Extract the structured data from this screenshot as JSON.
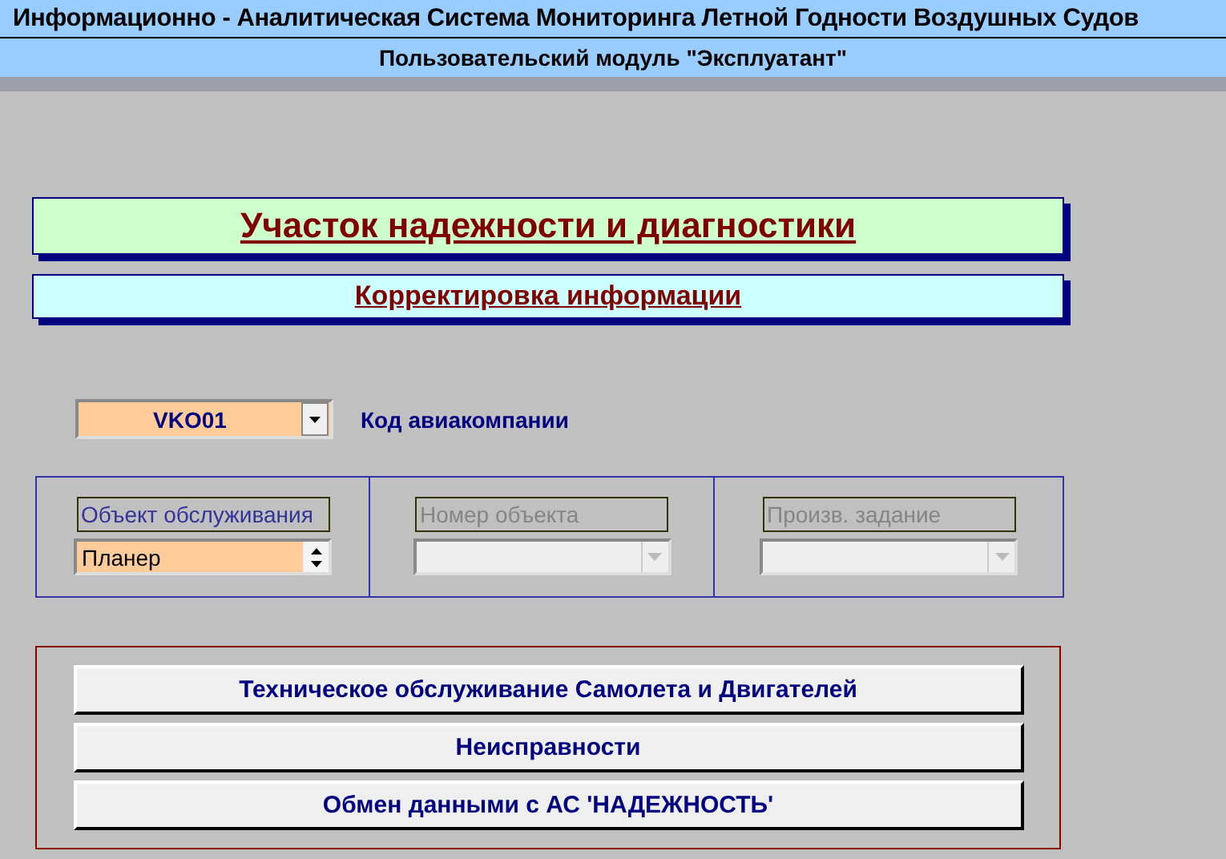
{
  "header": {
    "title": "Информационно - Аналитическая Система Мониторинга Летной Годности Воздушных Судов",
    "subtitle": "Пользовательский модуль \"Эксплуатант\""
  },
  "section_title": "Участок надежности и диагностики",
  "subsection_title": "Корректировка  информации",
  "airline": {
    "value": "VKO01",
    "label": "Код авиакомпании"
  },
  "fields": [
    {
      "label": "Объект обслуживания",
      "value": "Планер",
      "kind": "spinner",
      "disabled": false
    },
    {
      "label": "Номер объекта",
      "kind": "dropdown",
      "disabled": true
    },
    {
      "label": "Произв. задание",
      "kind": "dropdown",
      "disabled": true
    }
  ],
  "buttons": [
    "Техническое обслуживание  Самолета и Двигателей",
    "Неисправности",
    "Обмен данными с АС 'НАДЕЖНОСТЬ'"
  ]
}
